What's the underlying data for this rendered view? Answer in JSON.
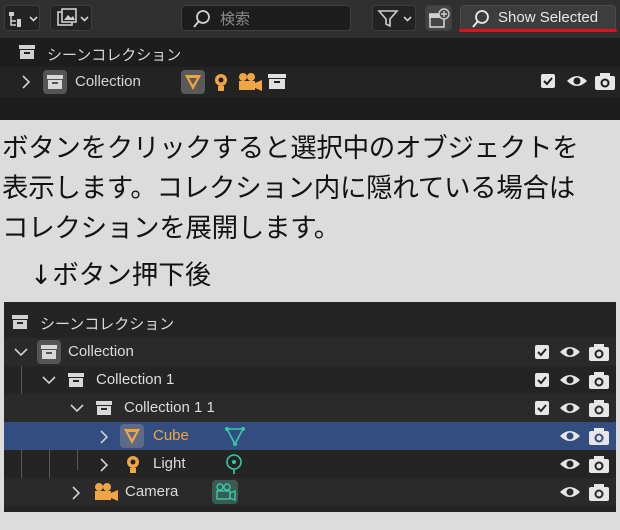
{
  "top_outliner": {
    "search": {
      "placeholder": "検索"
    },
    "show_selected_label": "Show Selected",
    "rows": [
      {
        "label": "シーンコレクション",
        "icon": "collection-box-icon"
      },
      {
        "label": "Collection",
        "icon": "collection-box-icon",
        "content_icons": [
          "mesh-cone-icon",
          "light-bulb-icon",
          "camera-icon",
          "collection-box-icon"
        ],
        "toggles": [
          "checkbox-checked",
          "eye-icon",
          "camera-render-icon"
        ]
      }
    ]
  },
  "description": {
    "lines": [
      "ボタンをクリックすると選択中のオブジェクトを",
      "表示します。コレクション内に隠れている場合は",
      "コレクションを展開します。"
    ],
    "after_label": "↓ボタン押下後"
  },
  "bottom_outliner": {
    "rows": [
      {
        "label": "シーンコレクション"
      },
      {
        "label": "Collection"
      },
      {
        "label": "Collection 1"
      },
      {
        "label": "Collection 1 1"
      },
      {
        "label": "Cube",
        "selected": true
      },
      {
        "label": "Light"
      },
      {
        "label": "Camera"
      }
    ]
  },
  "colors": {
    "accent_selected_row": "#334d80",
    "selected_text": "#f0a545",
    "object_data_teal": "#36c9a8",
    "underline_red": "#d9141e"
  }
}
